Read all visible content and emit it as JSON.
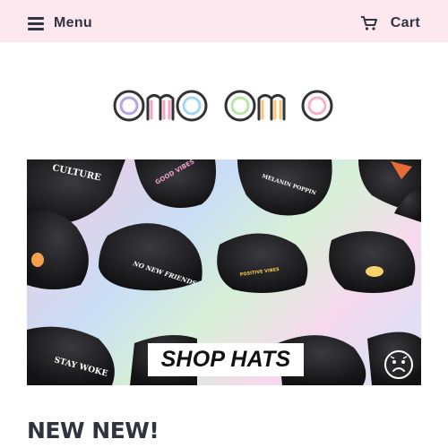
{
  "header": {
    "menu_label": "Menu",
    "cart_label": "Cart",
    "menu_icon": "hamburger-icon",
    "cart_icon": "shopping-cart-icon",
    "background": "#fde8ef"
  },
  "logo": {
    "text": "omoomo"
  },
  "banner": {
    "button_label": "SHOP HATS",
    "hat_texts": [
      "CULTURE",
      "GOOD VIBES",
      "MELANIN POPPIN",
      "NO NEW FRIENDS",
      "POSITIVE VIBES",
      "STAY WOKE"
    ],
    "chat_icon": "sad-face-chat-icon"
  },
  "section": {
    "title": "NEW NEW!"
  }
}
